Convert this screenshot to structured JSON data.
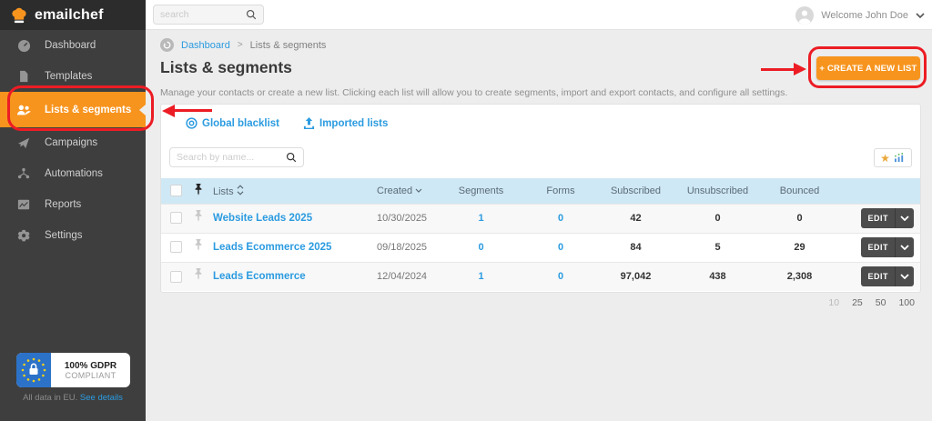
{
  "brand": {
    "name": "emailchef"
  },
  "topbar": {
    "search_placeholder": "search",
    "welcome": "Welcome John Doe"
  },
  "sidebar": {
    "items": [
      {
        "label": "Dashboard"
      },
      {
        "label": "Templates"
      },
      {
        "label": "Lists & segments"
      },
      {
        "label": "Campaigns"
      },
      {
        "label": "Automations"
      },
      {
        "label": "Reports"
      },
      {
        "label": "Settings"
      }
    ],
    "gdpr": {
      "line1": "100% GDPR",
      "line2": "COMPLIANT",
      "footer_text": "All data in EU.",
      "footer_link": "See details"
    }
  },
  "breadcrumb": {
    "home": "Dashboard",
    "separator": ">",
    "current": "Lists & segments"
  },
  "page": {
    "title": "Lists & segments",
    "description": "Manage your contacts or create a new list. Clicking each list will allow you to create segments, import and export contacts, and configure all settings.",
    "create_button": "+ CREATE A NEW LIST"
  },
  "panel": {
    "links": {
      "blacklist": "Global blacklist",
      "imported": "Imported lists"
    },
    "search_placeholder": "Search by name...",
    "table": {
      "columns": [
        "Lists",
        "Created",
        "Segments",
        "Forms",
        "Subscribed",
        "Unsubscribed",
        "Bounced"
      ],
      "rows": [
        {
          "name": "Website Leads 2025",
          "created": "10/30/2025",
          "segments": "1",
          "forms": "0",
          "subscribed": "42",
          "unsubscribed": "0",
          "bounced": "0",
          "edit": "EDIT"
        },
        {
          "name": "Leads Ecommerce 2025",
          "created": "09/18/2025",
          "segments": "0",
          "forms": "0",
          "subscribed": "84",
          "unsubscribed": "5",
          "bounced": "29",
          "edit": "EDIT"
        },
        {
          "name": "Leads Ecommerce",
          "created": "12/04/2024",
          "segments": "1",
          "forms": "0",
          "subscribed": "97,042",
          "unsubscribed": "438",
          "bounced": "2,308",
          "edit": "EDIT"
        }
      ]
    },
    "pagination": [
      "10",
      "25",
      "50",
      "100"
    ]
  },
  "colors": {
    "accent_orange": "#f7941e",
    "annotation_red": "#ec1c24",
    "link_blue": "#2b9be0",
    "table_header_blue": "#cfe8f5",
    "sidebar_bg": "#3e3e3e"
  }
}
